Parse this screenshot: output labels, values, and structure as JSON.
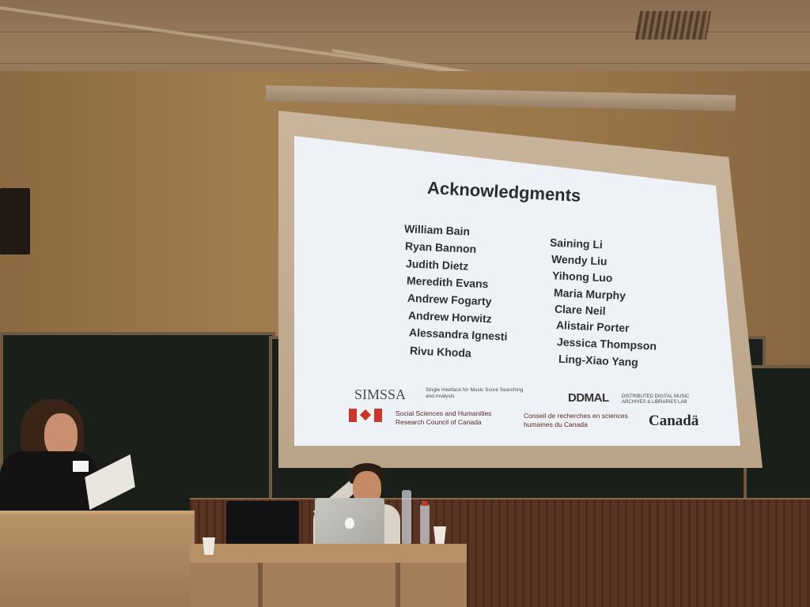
{
  "slide": {
    "title": "Acknowledgments",
    "names_left": [
      "William Bain",
      "Ryan Bannon",
      "Judith Dietz",
      "Meredith Evans",
      "Andrew Fogarty",
      "Andrew Horwitz",
      "Alessandra Ignesti",
      "Rivu Khoda"
    ],
    "names_right": [
      "Saining Li",
      "Wendy Liu",
      "Yihong Luo",
      "Maria Murphy",
      "Clare Neil",
      "Alistair Porter",
      "Jessica Thompson",
      "Ling-Xiao Yang"
    ],
    "logos": {
      "simssa": "SIMSSA",
      "simssa_sub": "Single Interface for Music Score Searching and Analysis",
      "ddmal": "DDMAL",
      "ddmal_sub": "DISTRIBUTED DIGITAL MUSIC ARCHIVES & LIBRARIES LAB",
      "sshrc_en": "Social Sciences and Humanities Research Council of Canada",
      "sshrc_fr": "Conseil de recherches en sciences humaines du Canada",
      "canada": "Canadä"
    }
  },
  "colors": {
    "slide_background": "#eef1f6",
    "slide_text": "#2b2d33",
    "wall": "#a07c4f",
    "chalkboard": "#1b1f19",
    "flag_red": "#c8362c"
  },
  "icons": {
    "laptop_logo": "apple-icon",
    "flag": "canada-flag-icon"
  }
}
